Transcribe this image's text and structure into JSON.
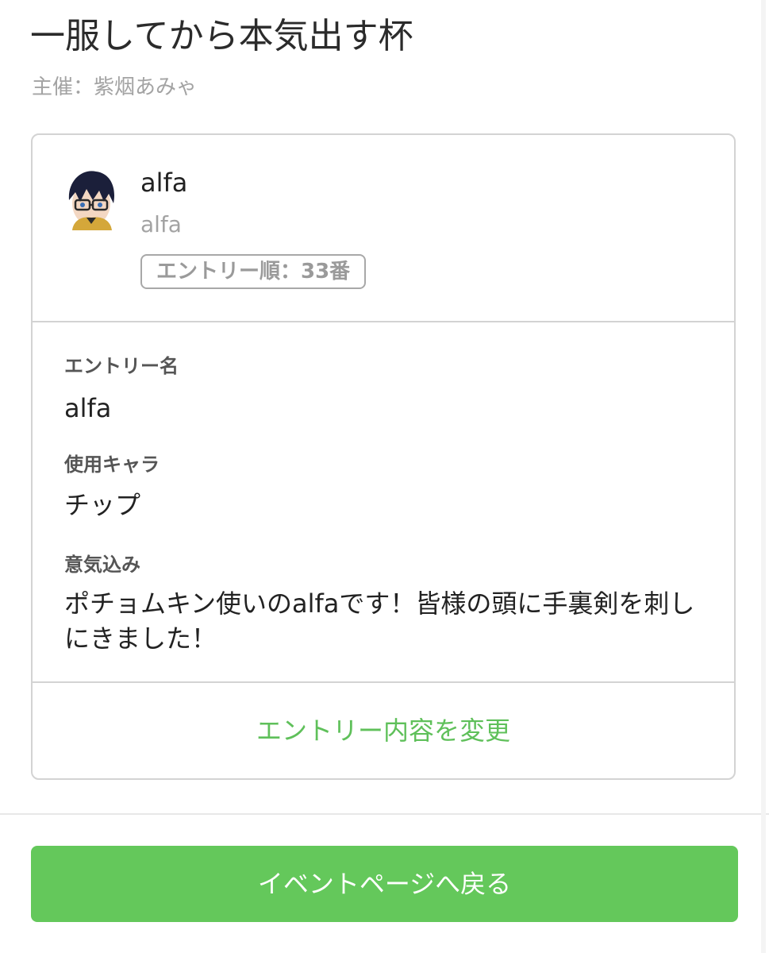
{
  "event": {
    "title": "一服してから本気出す杯",
    "organizer": "主催：紫烟あみゃ"
  },
  "entry": {
    "display_name": "alfa",
    "user_id": "alfa",
    "order_badge": "エントリー順：33番",
    "avatar_icon": "user-avatar-icon"
  },
  "details": [
    {
      "label": "エントリー名",
      "value": "alfa"
    },
    {
      "label": "使用キャラ",
      "value": "チップ"
    },
    {
      "label": "意気込み",
      "value": "ポチョムキン使いのalfaです！皆様の頭に手裏剣を刺しにきました！"
    }
  ],
  "actions": {
    "edit_entry": "エントリー内容を変更",
    "back_to_event": "イベントページへ戻る"
  },
  "colors": {
    "accent": "#64c85b",
    "link": "#5fc05a",
    "border": "#d3d3d3",
    "muted_text": "#a3a3a3"
  }
}
